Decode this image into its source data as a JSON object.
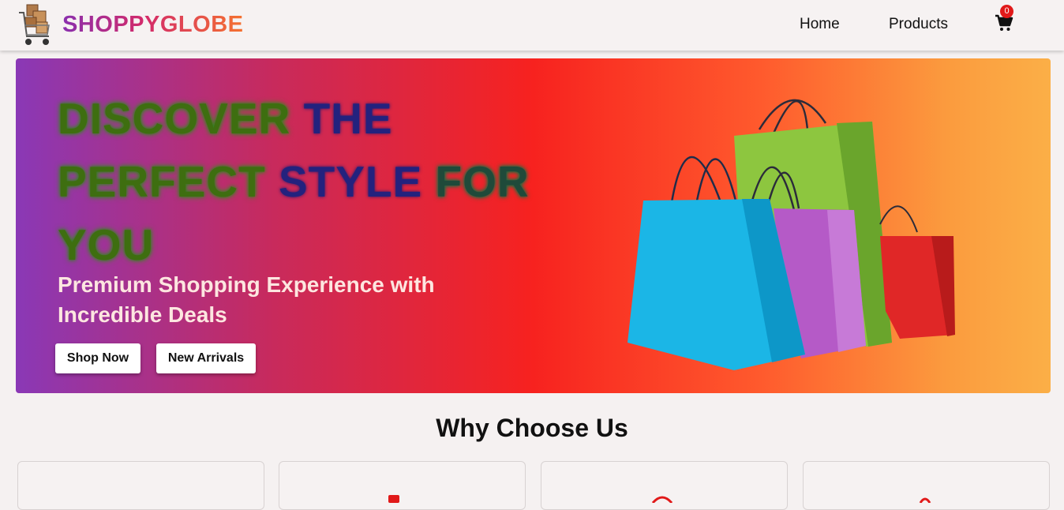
{
  "header": {
    "brand": "SHOPPYGLOBE",
    "nav": {
      "home": "Home",
      "products": "Products"
    },
    "cart_count": "0",
    "icons": {
      "logo": "shopping-cart-with-boxes-icon",
      "cart": "cart-icon"
    }
  },
  "hero": {
    "title_words": [
      "DISCOVER",
      "THE",
      "PERFECT",
      "STYLE",
      "FOR",
      "YOU"
    ],
    "subtitle": "Premium Shopping Experience with Incredible Deals",
    "buttons": {
      "shop_now": "Shop Now",
      "new_arrivals": "New Arrivals"
    },
    "image": "shopping-bags-illustration",
    "gradient_colors": [
      "#8a38b6",
      "#f7221f",
      "#fbaf47"
    ]
  },
  "why": {
    "title": "Why Choose Us",
    "cards": [
      {
        "icon": "feature-icon-1"
      },
      {
        "icon": "feature-icon-2"
      },
      {
        "icon": "feature-icon-3"
      },
      {
        "icon": "feature-icon-4"
      }
    ]
  },
  "colors": {
    "accent": "#e11919",
    "background": "#f5f1f1"
  }
}
